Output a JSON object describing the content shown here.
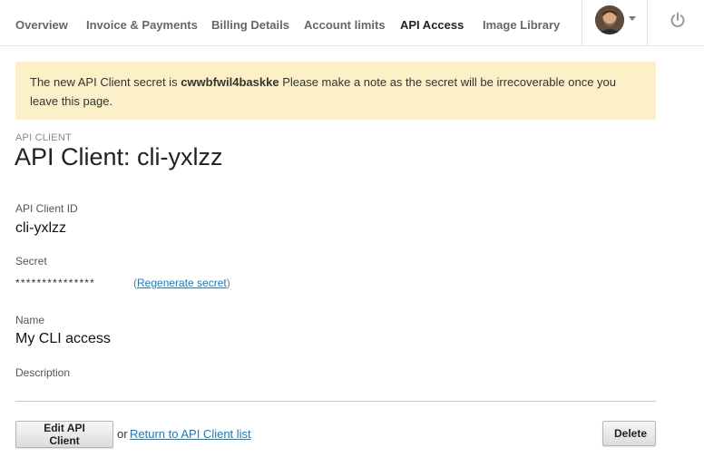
{
  "nav": {
    "items": [
      {
        "label": "Overview",
        "active": false
      },
      {
        "label": "Invoice & Payments",
        "active": false
      },
      {
        "label": "Billing Details",
        "active": false
      },
      {
        "label": "Account limits",
        "active": false
      },
      {
        "label": "API Access",
        "active": true
      },
      {
        "label": "Image Library",
        "active": false
      }
    ],
    "user_menu_icon": "chevron-down-icon",
    "power_icon": "power-icon"
  },
  "alert": {
    "prefix": "The new API Client secret is ",
    "secret": "cwwbfwil4baskke",
    "suffix": " Please make a note as the secret will be irrecoverable once you leave this page.",
    "background": "#fcf0c8"
  },
  "page": {
    "eyebrow": "API CLIENT",
    "title": "API Client: cli-yxlzz"
  },
  "fields": {
    "client_id_label": "API Client ID",
    "client_id_value": "cli-yxlzz",
    "secret_label": "Secret",
    "secret_masked": "***************",
    "regen_open": "(",
    "regen_link": "Regenerate secret",
    "regen_close": ")",
    "name_label": "Name",
    "name_value": "My CLI access",
    "description_label": "Description"
  },
  "actions": {
    "edit_label": "Edit API Client",
    "or_text": "or",
    "return_link": "Return to API Client list",
    "delete_label": "Delete"
  },
  "colors": {
    "link": "#1a7bb9",
    "active_nav": "#222222",
    "nav": "#666666"
  }
}
